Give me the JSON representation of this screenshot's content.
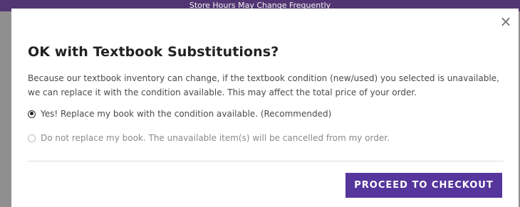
{
  "banner": {
    "text": "Store Hours May Change Frequently"
  },
  "modal": {
    "close_glyph": "×",
    "title": "OK with Textbook Substitutions?",
    "description": "Because our textbook inventory can change, if the textbook condition (new/used) you selected is unavailable, we can replace it with the condition available. This may affect the total price of your order.",
    "options": [
      {
        "label": "Yes! Replace my book with the condition available. (Recommended)",
        "selected": true
      },
      {
        "label": "Do not replace my book. The unavailable item(s) will be cancelled from my order.",
        "selected": false
      }
    ],
    "checkout_button": "PROCEED TO CHECKOUT"
  },
  "colors": {
    "accent": "#56359c",
    "banner": "#4b2c6f",
    "overlay": "#8f8f8f"
  }
}
